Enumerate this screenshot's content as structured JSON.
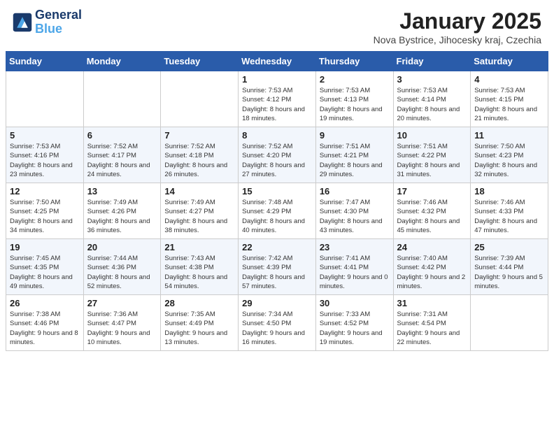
{
  "header": {
    "logo_line1": "General",
    "logo_line2": "Blue",
    "month_title": "January 2025",
    "location": "Nova Bystrice, Jihocesky kraj, Czechia"
  },
  "days_of_week": [
    "Sunday",
    "Monday",
    "Tuesday",
    "Wednesday",
    "Thursday",
    "Friday",
    "Saturday"
  ],
  "weeks": [
    [
      {
        "day": "",
        "info": ""
      },
      {
        "day": "",
        "info": ""
      },
      {
        "day": "",
        "info": ""
      },
      {
        "day": "1",
        "info": "Sunrise: 7:53 AM\nSunset: 4:12 PM\nDaylight: 8 hours and 18 minutes."
      },
      {
        "day": "2",
        "info": "Sunrise: 7:53 AM\nSunset: 4:13 PM\nDaylight: 8 hours and 19 minutes."
      },
      {
        "day": "3",
        "info": "Sunrise: 7:53 AM\nSunset: 4:14 PM\nDaylight: 8 hours and 20 minutes."
      },
      {
        "day": "4",
        "info": "Sunrise: 7:53 AM\nSunset: 4:15 PM\nDaylight: 8 hours and 21 minutes."
      }
    ],
    [
      {
        "day": "5",
        "info": "Sunrise: 7:53 AM\nSunset: 4:16 PM\nDaylight: 8 hours and 23 minutes."
      },
      {
        "day": "6",
        "info": "Sunrise: 7:52 AM\nSunset: 4:17 PM\nDaylight: 8 hours and 24 minutes."
      },
      {
        "day": "7",
        "info": "Sunrise: 7:52 AM\nSunset: 4:18 PM\nDaylight: 8 hours and 26 minutes."
      },
      {
        "day": "8",
        "info": "Sunrise: 7:52 AM\nSunset: 4:20 PM\nDaylight: 8 hours and 27 minutes."
      },
      {
        "day": "9",
        "info": "Sunrise: 7:51 AM\nSunset: 4:21 PM\nDaylight: 8 hours and 29 minutes."
      },
      {
        "day": "10",
        "info": "Sunrise: 7:51 AM\nSunset: 4:22 PM\nDaylight: 8 hours and 31 minutes."
      },
      {
        "day": "11",
        "info": "Sunrise: 7:50 AM\nSunset: 4:23 PM\nDaylight: 8 hours and 32 minutes."
      }
    ],
    [
      {
        "day": "12",
        "info": "Sunrise: 7:50 AM\nSunset: 4:25 PM\nDaylight: 8 hours and 34 minutes."
      },
      {
        "day": "13",
        "info": "Sunrise: 7:49 AM\nSunset: 4:26 PM\nDaylight: 8 hours and 36 minutes."
      },
      {
        "day": "14",
        "info": "Sunrise: 7:49 AM\nSunset: 4:27 PM\nDaylight: 8 hours and 38 minutes."
      },
      {
        "day": "15",
        "info": "Sunrise: 7:48 AM\nSunset: 4:29 PM\nDaylight: 8 hours and 40 minutes."
      },
      {
        "day": "16",
        "info": "Sunrise: 7:47 AM\nSunset: 4:30 PM\nDaylight: 8 hours and 43 minutes."
      },
      {
        "day": "17",
        "info": "Sunrise: 7:46 AM\nSunset: 4:32 PM\nDaylight: 8 hours and 45 minutes."
      },
      {
        "day": "18",
        "info": "Sunrise: 7:46 AM\nSunset: 4:33 PM\nDaylight: 8 hours and 47 minutes."
      }
    ],
    [
      {
        "day": "19",
        "info": "Sunrise: 7:45 AM\nSunset: 4:35 PM\nDaylight: 8 hours and 49 minutes."
      },
      {
        "day": "20",
        "info": "Sunrise: 7:44 AM\nSunset: 4:36 PM\nDaylight: 8 hours and 52 minutes."
      },
      {
        "day": "21",
        "info": "Sunrise: 7:43 AM\nSunset: 4:38 PM\nDaylight: 8 hours and 54 minutes."
      },
      {
        "day": "22",
        "info": "Sunrise: 7:42 AM\nSunset: 4:39 PM\nDaylight: 8 hours and 57 minutes."
      },
      {
        "day": "23",
        "info": "Sunrise: 7:41 AM\nSunset: 4:41 PM\nDaylight: 9 hours and 0 minutes."
      },
      {
        "day": "24",
        "info": "Sunrise: 7:40 AM\nSunset: 4:42 PM\nDaylight: 9 hours and 2 minutes."
      },
      {
        "day": "25",
        "info": "Sunrise: 7:39 AM\nSunset: 4:44 PM\nDaylight: 9 hours and 5 minutes."
      }
    ],
    [
      {
        "day": "26",
        "info": "Sunrise: 7:38 AM\nSunset: 4:46 PM\nDaylight: 9 hours and 8 minutes."
      },
      {
        "day": "27",
        "info": "Sunrise: 7:36 AM\nSunset: 4:47 PM\nDaylight: 9 hours and 10 minutes."
      },
      {
        "day": "28",
        "info": "Sunrise: 7:35 AM\nSunset: 4:49 PM\nDaylight: 9 hours and 13 minutes."
      },
      {
        "day": "29",
        "info": "Sunrise: 7:34 AM\nSunset: 4:50 PM\nDaylight: 9 hours and 16 minutes."
      },
      {
        "day": "30",
        "info": "Sunrise: 7:33 AM\nSunset: 4:52 PM\nDaylight: 9 hours and 19 minutes."
      },
      {
        "day": "31",
        "info": "Sunrise: 7:31 AM\nSunset: 4:54 PM\nDaylight: 9 hours and 22 minutes."
      },
      {
        "day": "",
        "info": ""
      }
    ]
  ]
}
